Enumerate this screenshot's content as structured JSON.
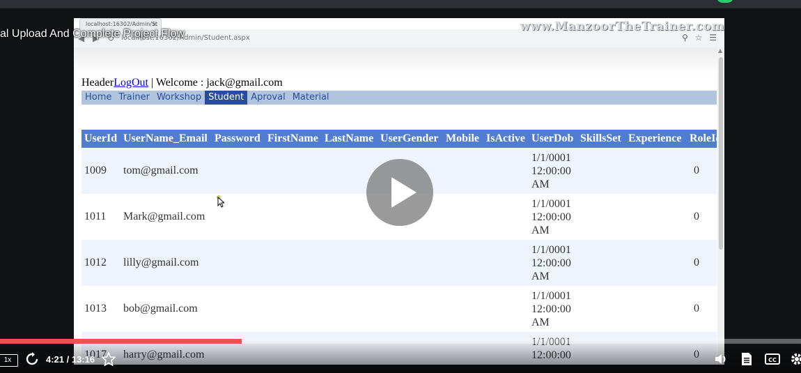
{
  "video": {
    "title": "al Upload And Complete Project Flow",
    "current_time": "4:21",
    "duration": "13:16",
    "time_separator": " / ",
    "progress": 0.302,
    "speed_label": "1x",
    "colors": {
      "progress": "#ec5252",
      "background": "#111214"
    }
  },
  "browser": {
    "tab_title": "localhost:16302/Admin/St",
    "tab_close": "×",
    "url": "localhost:16302/Admin/Student.aspx",
    "watermark": "www.ManzoorTheTrainer.com"
  },
  "page": {
    "header_text": "Header",
    "logout_link": "LogOut",
    "welcome": " | Welcome : jack@gmail.com",
    "menu": [
      {
        "label": "Home",
        "active": false
      },
      {
        "label": "Trainer",
        "active": false
      },
      {
        "label": "Workshop",
        "active": false
      },
      {
        "label": "Student",
        "active": true
      },
      {
        "label": "Aproval",
        "active": false
      },
      {
        "label": "Material",
        "active": false
      }
    ],
    "columns": [
      "UserId",
      "UserName_Email",
      "Password",
      "FirstName",
      "LastName",
      "UserGender",
      "Mobile",
      "IsActive",
      "UserDob",
      "SkillsSet",
      "Experience",
      "RoleId"
    ],
    "rows": [
      {
        "UserId": "1009",
        "UserName_Email": "tom@gmail.com",
        "UserDob": [
          "1/1/0001",
          "12:00:00",
          "AM"
        ],
        "RoleId": "0"
      },
      {
        "UserId": "1011",
        "UserName_Email": "Mark@gmail.com",
        "UserDob": [
          "1/1/0001",
          "12:00:00",
          "AM"
        ],
        "RoleId": "0"
      },
      {
        "UserId": "1012",
        "UserName_Email": "lilly@gmail.com",
        "UserDob": [
          "1/1/0001",
          "12:00:00",
          "AM"
        ],
        "RoleId": "0"
      },
      {
        "UserId": "1013",
        "UserName_Email": "bob@gmail.com",
        "UserDob": [
          "1/1/0001",
          "12:00:00",
          "AM"
        ],
        "RoleId": "0"
      },
      {
        "UserId": "1017",
        "UserName_Email": "harry@gmail.com",
        "UserDob": [
          "1/1/0001",
          "12:00:00",
          ""
        ],
        "RoleId": "0"
      }
    ],
    "colors": {
      "menu_bg": "#b0c4de",
      "menu_active": "#284e98",
      "header_bg": "#507cd1",
      "row_alt": "#eff3fb"
    }
  }
}
